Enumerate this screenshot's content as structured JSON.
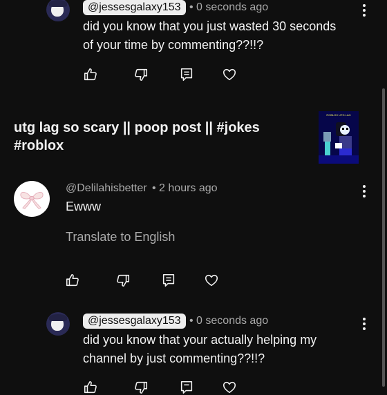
{
  "comments": [
    {
      "handle": "@jessesgalaxy153",
      "time": "• 0 seconds ago",
      "text_lines": [
        "did you know that you just wasted 30 seconds",
        "of your time by commenting??!!?"
      ]
    },
    {
      "handle": "@Delilahisbetter",
      "time": "• 2 hours ago",
      "text": "Ewww",
      "translate_label": "Translate to English"
    },
    {
      "handle": "@jessesgalaxy153",
      "time": "• 0 seconds ago",
      "text_lines": [
        "did you know that your actually helping my",
        "channel by just commenting??!!?"
      ]
    }
  ],
  "video": {
    "title_lines": [
      "utg lag so scary || poop post || #jokes",
      "#roblox"
    ],
    "thumbnail_text": "ROBLOX UTG LAG"
  },
  "icons": {
    "like": "thumbs-up-icon",
    "dislike": "thumbs-down-icon",
    "reply": "reply-icon",
    "heart": "heart-icon",
    "menu": "more-vert-icon"
  },
  "colors": {
    "background": "#0f0f0f",
    "text": "#f1f1f1",
    "secondary": "#aaaaaa",
    "chip": "#ededed"
  }
}
